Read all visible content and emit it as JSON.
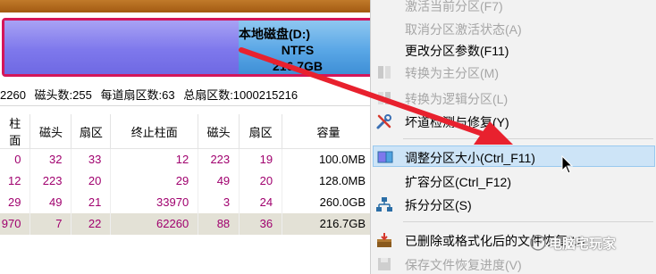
{
  "disk": {
    "partition_name": "本地磁盘(D:)",
    "filesystem": "NTFS",
    "size": "216.7GB",
    "used_fraction": 0.64
  },
  "info": {
    "cylinders": "2260",
    "heads": "磁头数:255",
    "sectors_per_track": "每道扇区数:63",
    "total_sectors": "总扇区数:1000215216"
  },
  "table": {
    "columns": [
      "柱面",
      "磁头",
      "扇区",
      "终止柱面",
      "磁头",
      "扇区",
      "容量"
    ],
    "rows": [
      {
        "cyl": "0",
        "head": "32",
        "sec": "33",
        "ecyl": "12",
        "ehead": "223",
        "esec": "19",
        "cap": "100.0MB"
      },
      {
        "cyl": "12",
        "head": "223",
        "sec": "20",
        "ecyl": "29",
        "ehead": "49",
        "esec": "20",
        "cap": "128.0MB"
      },
      {
        "cyl": "29",
        "head": "49",
        "sec": "21",
        "ecyl": "33970",
        "ehead": "3",
        "esec": "24",
        "cap": "260.0GB"
      },
      {
        "cyl": "970",
        "head": "7",
        "sec": "22",
        "ecyl": "62260",
        "ehead": "88",
        "esec": "36",
        "cap": "216.7GB"
      }
    ]
  },
  "menu": {
    "items": [
      {
        "label": "激活当前分区(F7)",
        "disabled": true
      },
      {
        "label": "取消分区激活状态(A)",
        "disabled": true
      },
      {
        "label": "更改分区参数(F11)",
        "disabled": false
      },
      {
        "label": "转换为主分区(M)",
        "disabled": true
      },
      {
        "label": "转换为逻辑分区(L)",
        "disabled": true
      },
      {
        "label": "坏道检测与修复(Y)",
        "disabled": false
      },
      {
        "label": "调整分区大小(Ctrl_F11)",
        "disabled": false
      },
      {
        "label": "扩容分区(Ctrl_F12)",
        "disabled": false
      },
      {
        "label": "拆分分区(S)",
        "disabled": false
      },
      {
        "label": "已删除或格式化后的文件恢复(U)",
        "disabled": false
      },
      {
        "label": "保存文件恢复进度(V)",
        "disabled": true
      }
    ]
  },
  "watermark": {
    "text": "电脑宅玩家"
  },
  "colors": {
    "accent_red": "#e8212e",
    "partition_border": "#d4165a",
    "menu_highlight": "#cde4f7",
    "value_color": "#a0006e"
  }
}
